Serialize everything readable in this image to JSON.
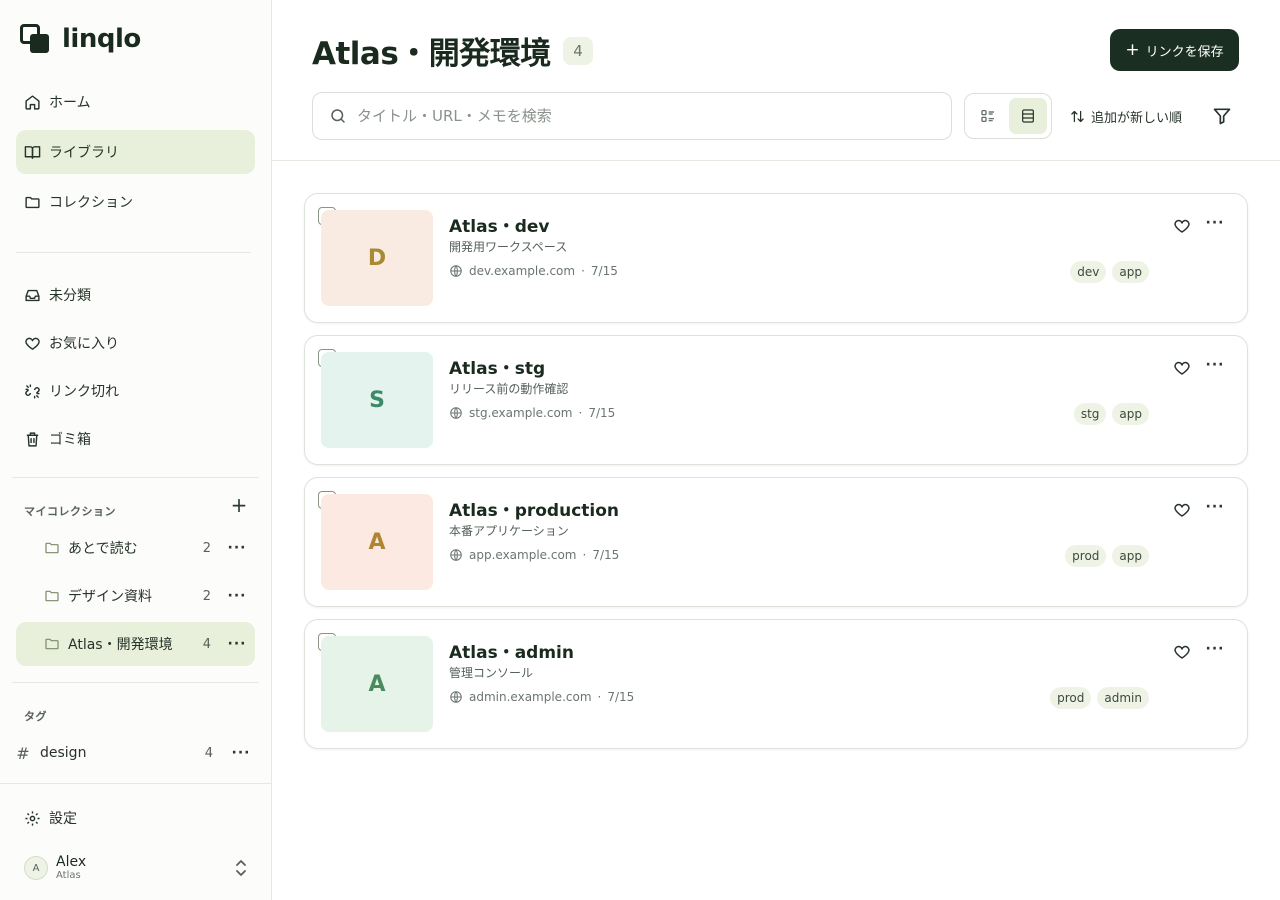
{
  "app": {
    "name": "linqlo"
  },
  "sidebar": {
    "nav": [
      {
        "label": "ホーム",
        "icon": "home-icon"
      },
      {
        "label": "ライブラリ",
        "icon": "book-icon",
        "active": true
      },
      {
        "label": "コレクション",
        "icon": "folder-icon"
      }
    ],
    "nav2": [
      {
        "label": "未分類",
        "icon": "inbox-icon"
      },
      {
        "label": "お気に入り",
        "icon": "heart-icon"
      },
      {
        "label": "リンク切れ",
        "icon": "broken-link-icon"
      },
      {
        "label": "ゴミ箱",
        "icon": "trash-icon"
      }
    ],
    "my_collections_label": "マイコレクション",
    "add_label": "+",
    "collections": [
      {
        "label": "あとで読む",
        "count": "2"
      },
      {
        "label": "デザイン資料",
        "count": "2"
      },
      {
        "label": "Atlas・開発環境",
        "count": "4",
        "active": true
      }
    ],
    "tags_label": "タグ",
    "tags": [
      {
        "label": "design",
        "count": "4"
      }
    ],
    "settings_label": "設定",
    "user": {
      "initial": "A",
      "name": "Alex",
      "workspace": "Atlas"
    }
  },
  "header": {
    "title": "Atlas・開発環境",
    "count": "4",
    "save_label": "リンクを保存",
    "search_placeholder": "タイトル・URL・メモを検索",
    "sort_label": "追加が新しい順"
  },
  "links": [
    {
      "initial": "D",
      "title": "Atlas・dev",
      "desc": "開発用ワークスペース",
      "domain": "dev.example.com",
      "date": "7/15",
      "tags": [
        "dev",
        "app"
      ],
      "thumb_bg": "#f9ebe1",
      "thumb_fg": "#a88a35"
    },
    {
      "initial": "S",
      "title": "Atlas・stg",
      "desc": "リリース前の動作確認",
      "domain": "stg.example.com",
      "date": "7/15",
      "tags": [
        "stg",
        "app"
      ],
      "thumb_bg": "#e5f3ef",
      "thumb_fg": "#3d8a6a"
    },
    {
      "initial": "A",
      "title": "Atlas・production",
      "desc": "本番アプリケーション",
      "domain": "app.example.com",
      "date": "7/15",
      "tags": [
        "prod",
        "app"
      ],
      "thumb_bg": "#fbe9e2",
      "thumb_fg": "#b0852f"
    },
    {
      "initial": "A",
      "title": "Atlas・admin",
      "desc": "管理コンソール",
      "domain": "admin.example.com",
      "date": "7/15",
      "tags": [
        "prod",
        "admin"
      ],
      "thumb_bg": "#e5f3e8",
      "thumb_fg": "#4b8a5a"
    }
  ],
  "colors": {
    "accent": "#1a2e22",
    "active_bg": "#e8f0dc",
    "tag_bg": "#eef3e6"
  }
}
